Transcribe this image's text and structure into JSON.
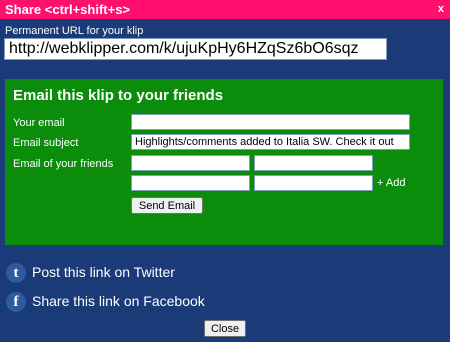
{
  "dialog": {
    "title": "Share <ctrl+shift+s>",
    "close_glyph": "x"
  },
  "permalink": {
    "label": "Permanent URL for your klip",
    "url": "http://webklipper.com/k/ujuKpHy6HZqSz6bO6sqz"
  },
  "email": {
    "heading": "Email this klip to your friends",
    "your_email_label": "Your email",
    "your_email_value": "",
    "subject_label": "Email subject",
    "subject_value": "Highlights/comments added to Italia SW. Check it out",
    "friends_label": "Email of your friends",
    "friends_values": [
      "",
      "",
      "",
      ""
    ],
    "add_label": "+ Add",
    "send_label": "Send Email"
  },
  "social": {
    "twitter_icon": "twitter-icon",
    "twitter_label": "Post this link on Twitter",
    "facebook_icon": "facebook-icon",
    "facebook_label": "Share this link on Facebook"
  },
  "footer": {
    "close_label": "Close"
  },
  "colors": {
    "background": "#1a3a78",
    "titlebar": "#ff0f6e",
    "panel": "#0b8d0b"
  }
}
